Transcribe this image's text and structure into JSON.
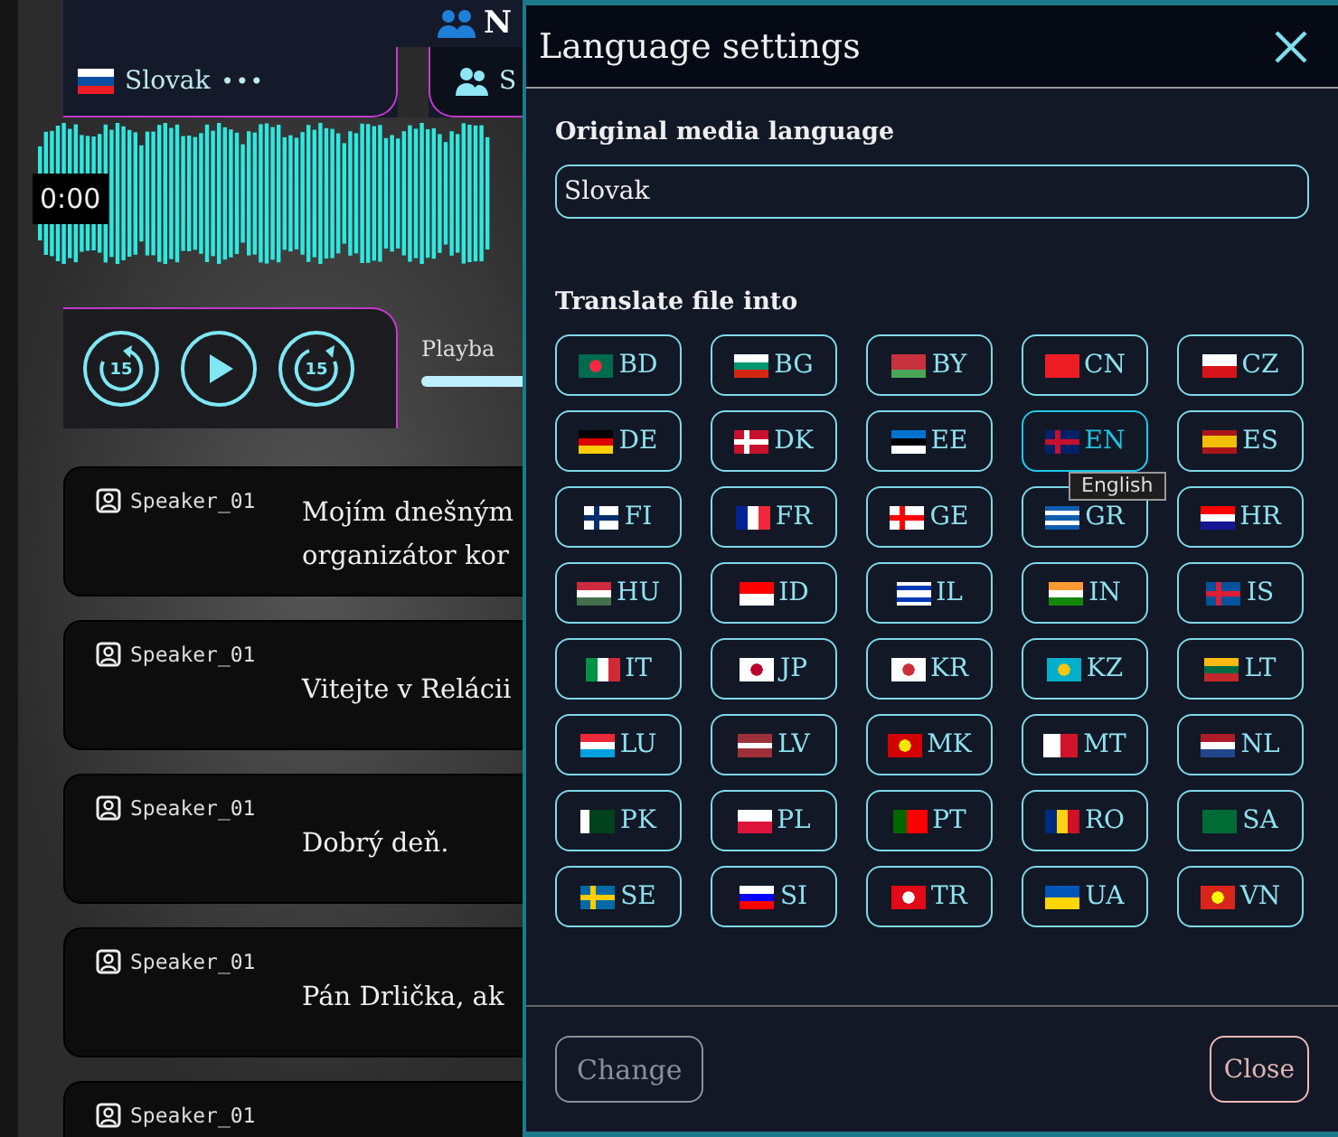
{
  "header": {
    "title": "N"
  },
  "player": {
    "tabs": [
      {
        "label": "Slovak",
        "menu": "•••",
        "selected": true
      },
      {
        "label": "S",
        "selected": false
      }
    ],
    "time": "0:00",
    "rewind_label": "15",
    "forward_label": "15",
    "playback": {
      "label": "Playba",
      "level": 1
    }
  },
  "transcript": [
    {
      "speaker": "Speaker_01",
      "text": "Mojím dnešným\norganizátor kor"
    },
    {
      "speaker": "Speaker_01",
      "text": "Vitejte v Relácii"
    },
    {
      "speaker": "Speaker_01",
      "text": "Dobrý deň."
    },
    {
      "speaker": "Speaker_01",
      "text": "Pán Drlička, ak"
    },
    {
      "speaker": "Speaker_01"
    }
  ],
  "dialog": {
    "title": "Language settings",
    "original_label": "Original media language",
    "original_value": "Slovak",
    "translate_label": "Translate file into",
    "languages": [
      {
        "code": "BD",
        "selected": false,
        "hovered": false
      },
      {
        "code": "BG",
        "selected": false,
        "hovered": false
      },
      {
        "code": "BY",
        "selected": false,
        "hovered": false
      },
      {
        "code": "CN",
        "selected": false,
        "hovered": false
      },
      {
        "code": "CZ",
        "selected": false,
        "hovered": false
      },
      {
        "code": "DE",
        "selected": false,
        "hovered": false
      },
      {
        "code": "DK",
        "selected": false,
        "hovered": false
      },
      {
        "code": "EE",
        "selected": false,
        "hovered": false
      },
      {
        "code": "EN",
        "selected": false,
        "hovered": true,
        "tooltip": "English"
      },
      {
        "code": "ES",
        "selected": false,
        "hovered": false
      },
      {
        "code": "FI",
        "selected": false,
        "hovered": false
      },
      {
        "code": "FR",
        "selected": false,
        "hovered": false
      },
      {
        "code": "GE",
        "selected": false,
        "hovered": false
      },
      {
        "code": "GR",
        "selected": false,
        "hovered": false
      },
      {
        "code": "HR",
        "selected": false,
        "hovered": false
      },
      {
        "code": "HU",
        "selected": false,
        "hovered": false
      },
      {
        "code": "ID",
        "selected": false,
        "hovered": false
      },
      {
        "code": "IL",
        "selected": false,
        "hovered": false
      },
      {
        "code": "IN",
        "selected": false,
        "hovered": false
      },
      {
        "code": "IS",
        "selected": false,
        "hovered": false
      },
      {
        "code": "IT",
        "selected": false,
        "hovered": false
      },
      {
        "code": "JP",
        "selected": false,
        "hovered": false
      },
      {
        "code": "KR",
        "selected": false,
        "hovered": false
      },
      {
        "code": "KZ",
        "selected": false,
        "hovered": false
      },
      {
        "code": "LT",
        "selected": false,
        "hovered": false
      },
      {
        "code": "LU",
        "selected": false,
        "hovered": false
      },
      {
        "code": "LV",
        "selected": false,
        "hovered": false
      },
      {
        "code": "MK",
        "selected": false,
        "hovered": false
      },
      {
        "code": "MT",
        "selected": false,
        "hovered": false
      },
      {
        "code": "NL",
        "selected": false,
        "hovered": false
      },
      {
        "code": "PK",
        "selected": false,
        "hovered": false
      },
      {
        "code": "PL",
        "selected": false,
        "hovered": false
      },
      {
        "code": "PT",
        "selected": false,
        "hovered": false
      },
      {
        "code": "RO",
        "selected": false,
        "hovered": false
      },
      {
        "code": "SA",
        "selected": false,
        "hovered": false
      },
      {
        "code": "SE",
        "selected": false,
        "hovered": false
      },
      {
        "code": "SI",
        "selected": false,
        "hovered": false
      },
      {
        "code": "TR",
        "selected": false,
        "hovered": false
      },
      {
        "code": "UA",
        "selected": false,
        "hovered": false
      },
      {
        "code": "VN",
        "selected": false,
        "hovered": false
      }
    ],
    "buttons": [
      {
        "label": "Change",
        "kind": "primary",
        "disabled": true
      },
      {
        "label": "Close",
        "kind": "secondary",
        "disabled": false
      }
    ]
  }
}
